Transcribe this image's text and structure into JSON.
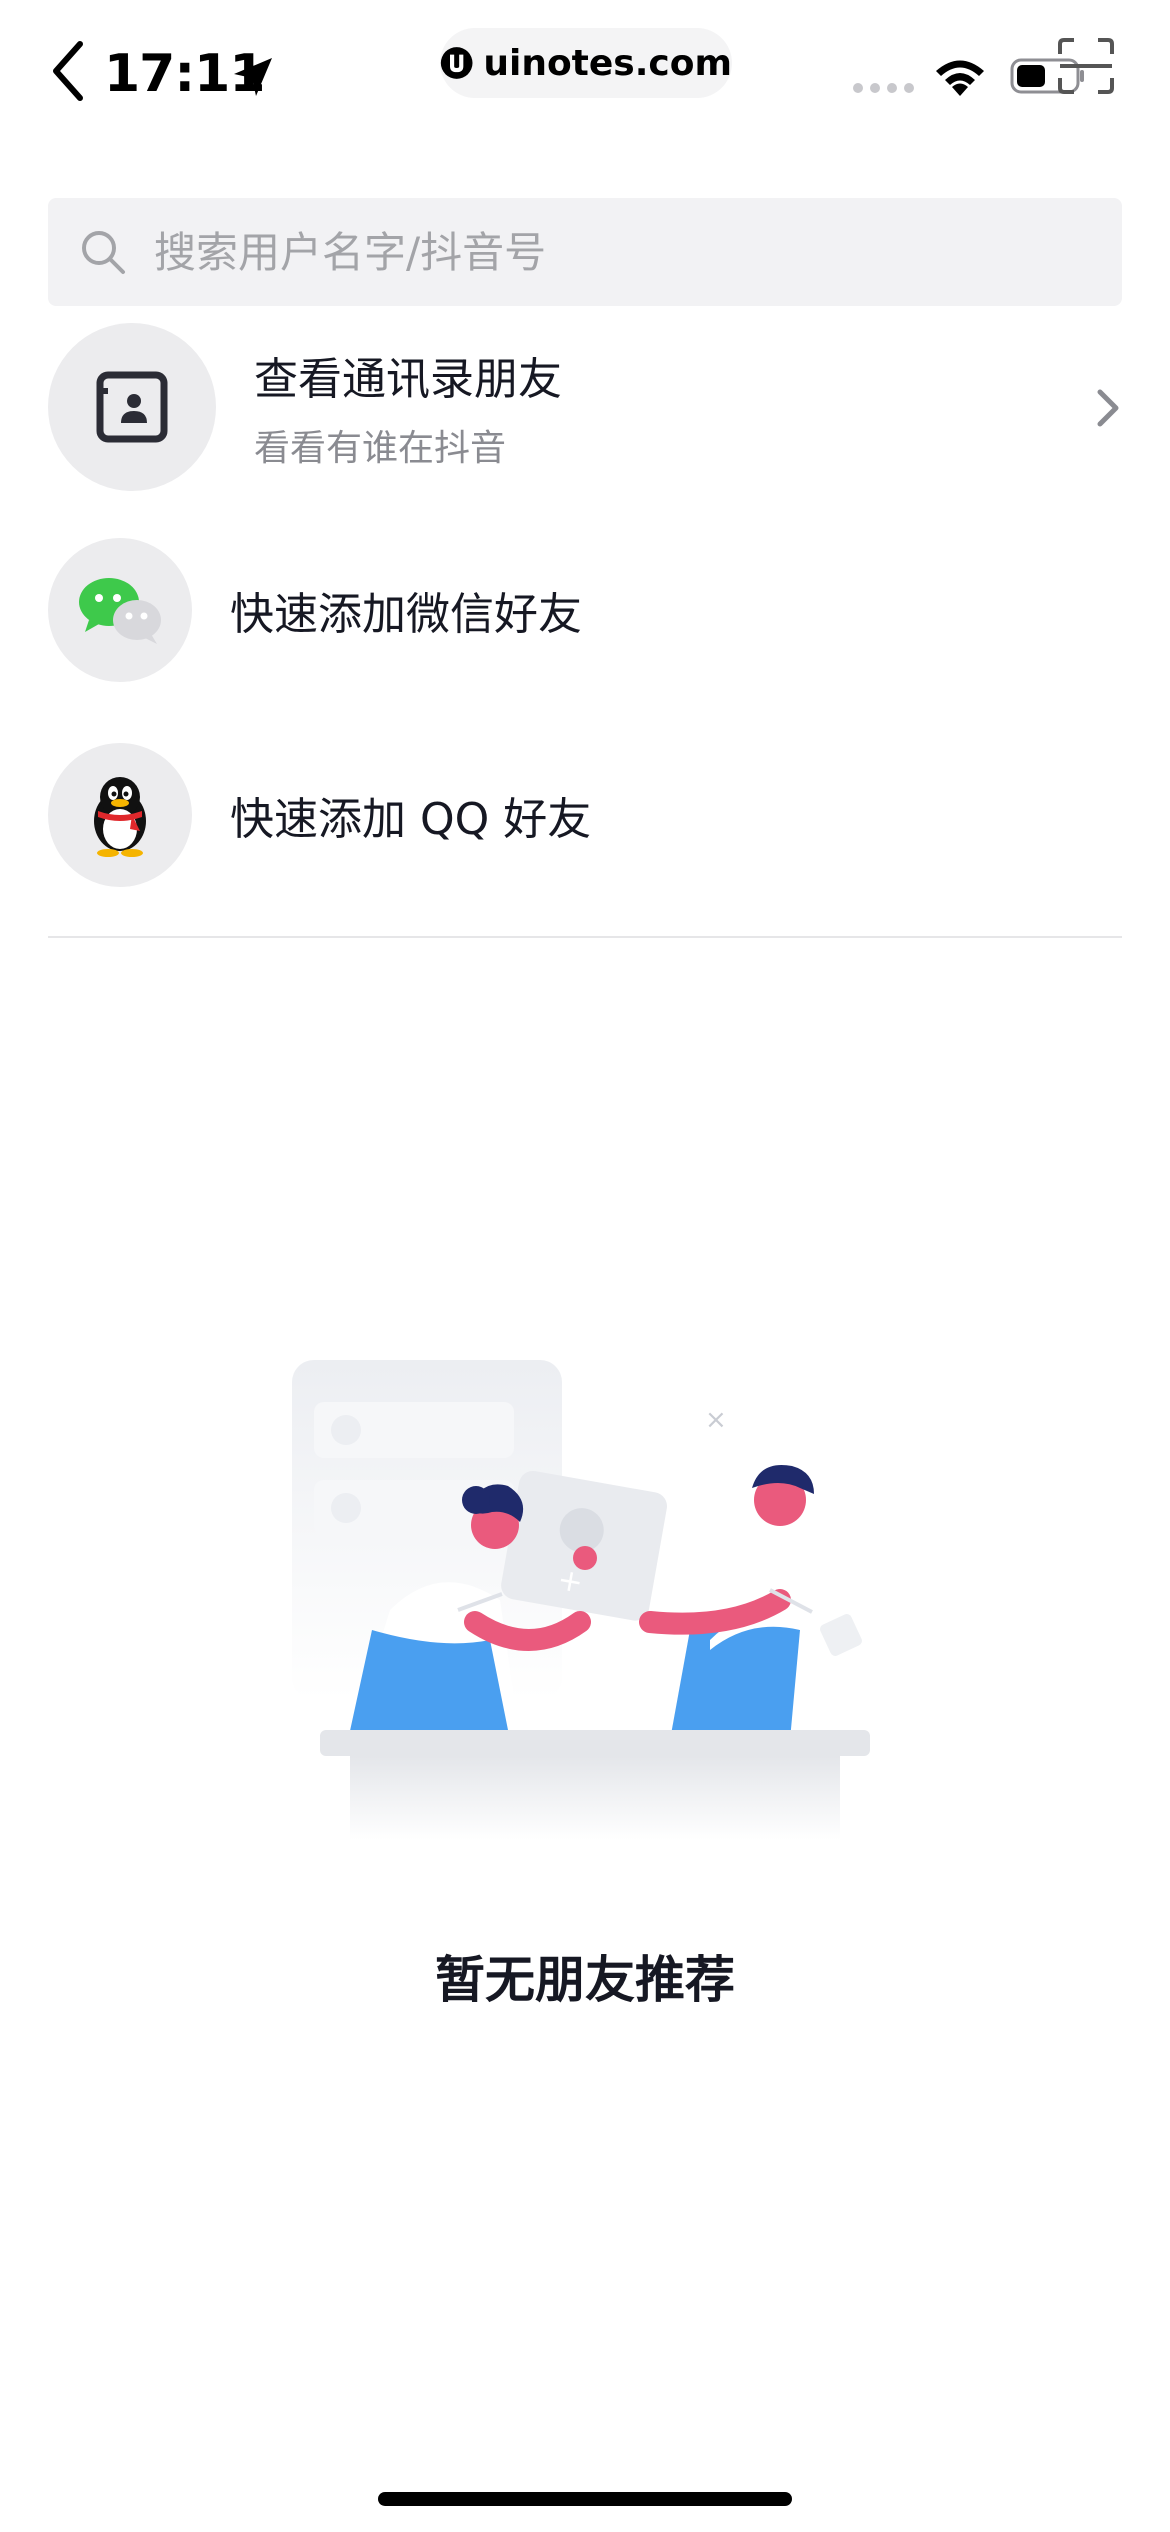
{
  "status_bar": {
    "time": "17:11",
    "url": "uinotes.com"
  },
  "search": {
    "placeholder": "搜索用户名字/抖音号"
  },
  "actions": {
    "contacts": {
      "title": "查看通讯录朋友",
      "subtitle": "看看有谁在抖音"
    },
    "wechat": {
      "title": "快速添加微信好友"
    },
    "qq": {
      "title": "快速添加 QQ 好友"
    }
  },
  "empty_state": {
    "message": "暂无朋友推荐"
  },
  "colors": {
    "text_primary": "#161823",
    "text_secondary": "#8a8b91",
    "search_bg": "#f2f2f4",
    "avatar_bg": "#ececee",
    "wechat_green": "#3ec94b",
    "illustration_pink": "#ea5a7d",
    "illustration_blue": "#4a9ff0",
    "illustration_navy": "#1f2a6b"
  }
}
